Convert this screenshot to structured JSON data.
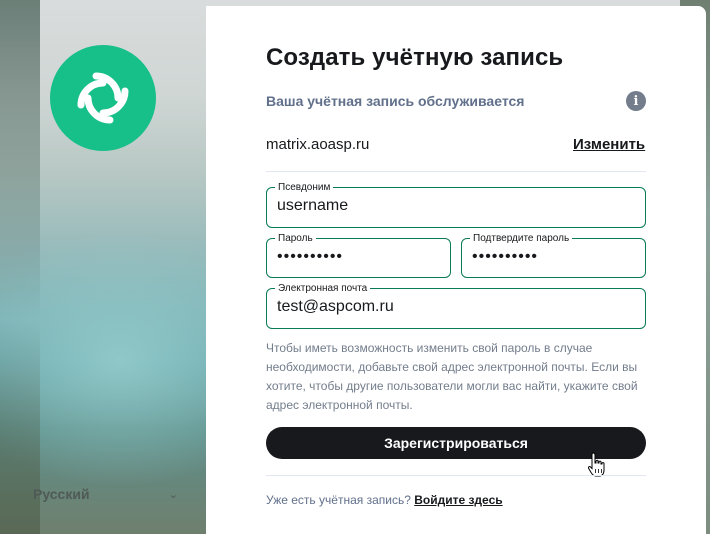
{
  "left_panel": {
    "language": "Русский",
    "brand_color": "#17bf89"
  },
  "card": {
    "title": "Создать учётную запись",
    "server_caption": "Ваша учётная запись обслуживается",
    "server_name": "matrix.aoasp.ru",
    "change_label": "Изменить",
    "fields": {
      "username": {
        "label": "Псевдоним",
        "value": "username"
      },
      "password": {
        "label": "Пароль",
        "value": "••••••••••"
      },
      "confirm": {
        "label": "Подтвердите пароль",
        "value": "••••••••••"
      },
      "email": {
        "label": "Электронная почта",
        "value": "test@aspcom.ru"
      }
    },
    "hint": "Чтобы иметь возможность изменить свой пароль в случае необходимости, добавьте свой адрес электронной почты. Если вы хотите, чтобы другие пользователи могли вас найти, укажите свой адрес электронной почты.",
    "register_label": "Зарегистрироваться",
    "footer_text": "Уже есть учётная запись?",
    "footer_link": "Войдите здесь"
  },
  "colors": {
    "field_border": "#0a7c55",
    "button_bg": "#17191c",
    "muted_text": "#737d8c"
  }
}
